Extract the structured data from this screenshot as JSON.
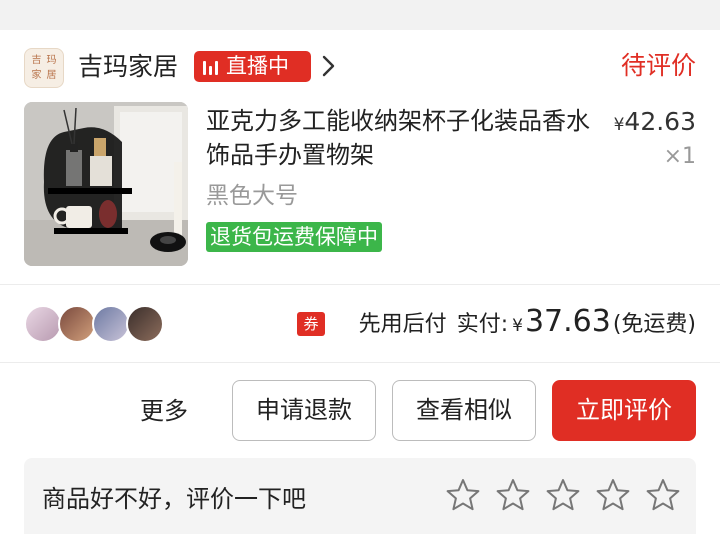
{
  "shop": {
    "logo_text": [
      "吉",
      "玛",
      "家",
      "居"
    ],
    "name": "吉玛家居",
    "live_badge": "直播中",
    "order_status": "待评价"
  },
  "product": {
    "title": "亚克力多工能收纳架杯子化装品香水饰品手办置物架",
    "currency": "¥",
    "price": "42.63",
    "quantity": "×1",
    "spec": "黑色大号",
    "guarantee": "退货包运费保障中"
  },
  "payment": {
    "coupon_icon": "券",
    "pay_later": "先用后付",
    "paid_label": "实付:",
    "currency": "¥",
    "amount": "37.63",
    "shipping": "(免运费)"
  },
  "actions": {
    "more": "更多",
    "refund": "申请退款",
    "similar": "查看相似",
    "review_now": "立即评价"
  },
  "review": {
    "prompt": "商品好不好，评价一下吧",
    "stars": 5
  },
  "colors": {
    "accent": "#e02e24",
    "guarantee_green": "#3cb64a",
    "muted_text": "#999999"
  },
  "icons": [
    "shop-logo-icon",
    "live-bars-icon",
    "chevron-right-icon",
    "coupon-icon",
    "star-outline-icon"
  ]
}
